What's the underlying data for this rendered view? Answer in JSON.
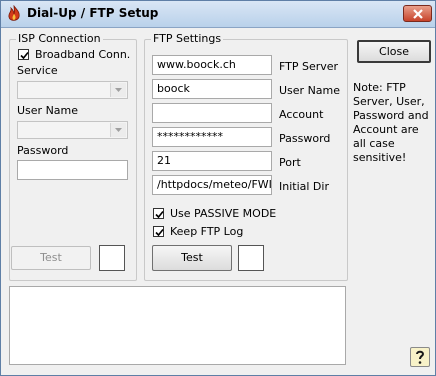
{
  "window": {
    "title": "Dial-Up / FTP Setup"
  },
  "isp": {
    "legend": "ISP Connection",
    "broadband_label": "Broadband Conn.",
    "broadband_checked": true,
    "service_label": "Service",
    "service_value": "",
    "username_label": "User Name",
    "username_value": "",
    "password_label": "Password",
    "password_value": "",
    "test_label": "Test"
  },
  "ftp": {
    "legend": "FTP Settings",
    "server_label": "FTP Server",
    "server_value": "www.boock.ch",
    "user_label": "User Name",
    "user_value": "boock",
    "account_label": "Account",
    "account_value": "",
    "password_label": "Password",
    "password_value": "************",
    "port_label": "Port",
    "port_value": "21",
    "dir_label": "Initial Dir",
    "dir_value": "/httpdocs/meteo/FWI/",
    "passive_label": "Use PASSIVE MODE",
    "passive_checked": true,
    "log_label": "Keep FTP Log",
    "log_checked": true,
    "test_label": "Test"
  },
  "close_label": "Close",
  "note": "Note: FTP Server, User, Password and Account are all case sensitive!",
  "help_icon": "help-question-icon"
}
